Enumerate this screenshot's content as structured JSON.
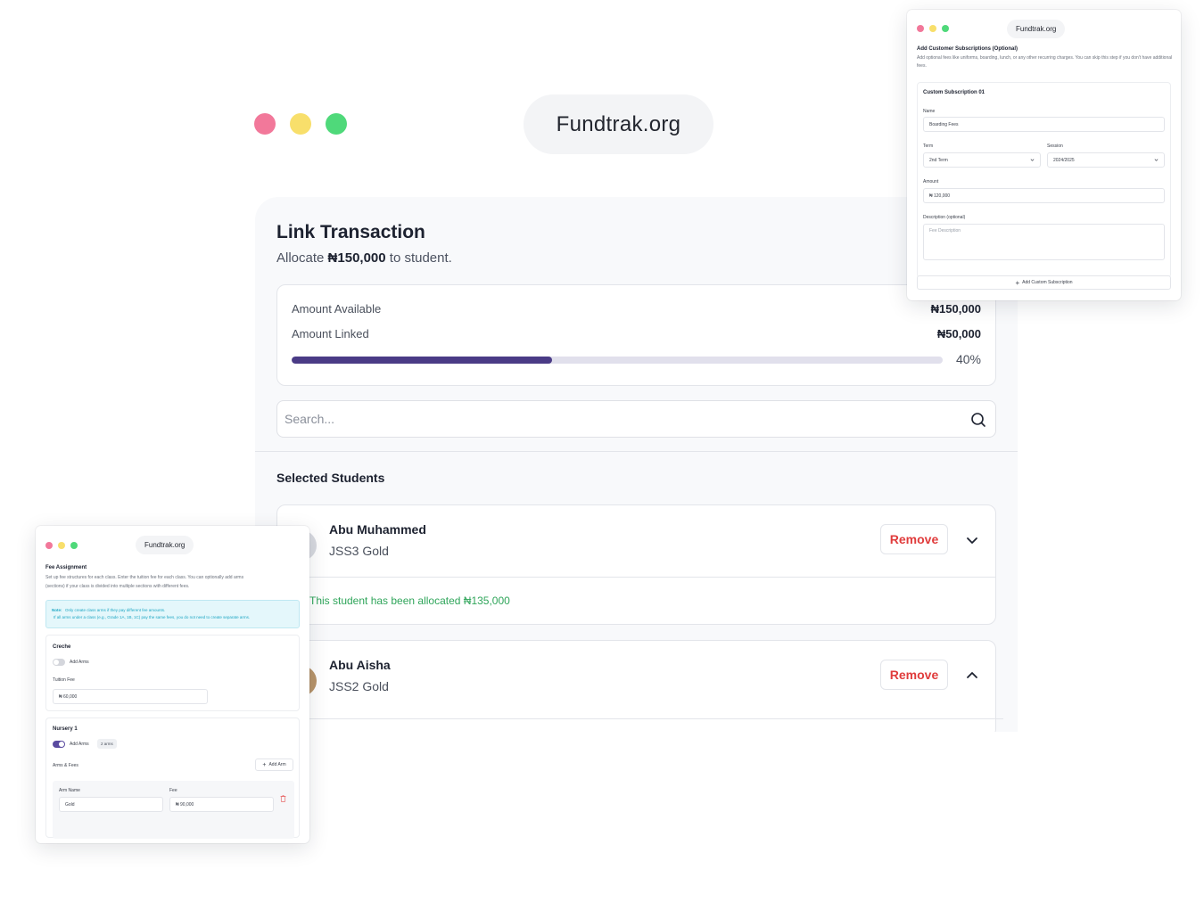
{
  "main_window": {
    "url": "Fundtrak.org",
    "title": "Link Transaction",
    "subtitle_prefix": "Allocate",
    "subtitle_amount": "₦150,000",
    "subtitle_suffix": "to student.",
    "summary": {
      "available_label": "Amount Available",
      "available_value": "₦150,000",
      "linked_label": "Amount Linked",
      "linked_value": "₦50,000",
      "progress_percent": 40,
      "progress_text": "40%"
    },
    "search": {
      "placeholder": "Search..."
    },
    "selected_title": "Selected Students",
    "students": [
      {
        "name": "Abu Muhammed",
        "class": "JSS3 Gold",
        "remove_label": "Remove",
        "expanded": true,
        "allocation_note": "This student has been allocated  ₦135,000"
      },
      {
        "name": "Abu Aisha",
        "class": "JSS2 Gold",
        "remove_label": "Remove",
        "expanded": false
      }
    ]
  },
  "subscription_window": {
    "url": "Fundtrak.org",
    "heading": "Add Customer Subscriptions (Optional)",
    "description": "Add optional fees like uniforms, boarding, lunch, or any other recurring charges. You can skip this step if you don't have additional fees.",
    "card_title": "Custom Subscription 01",
    "name_label": "Name",
    "name_value": "Boarding Fees",
    "term_label": "Term",
    "term_value": "2nd Term",
    "session_label": "Session",
    "session_value": "2024/2025",
    "amount_label": "Amount",
    "amount_value": "₦ 120,000",
    "description_label": "Description (optional)",
    "description_placeholder": "Fee Description",
    "add_button": "Add Custom Subscription"
  },
  "fee_window": {
    "url": "Fundtrak.org",
    "heading": "Fee Assignment",
    "description_line1": "Set up fee structures for each class. Enter the tuition fee for each class. You can optionally add arms",
    "description_line2": "(sections) if your class is divided into multiple sections with different fees.",
    "note_prefix": "Note:",
    "note_line1": "Only create class arms if they pay different fee amounts.",
    "note_line2": "If all arms under a class (e.g., Grade 1A, 1B, 1C) pay the same fees, you do not need to create separate arms.",
    "classes": [
      {
        "name": "Creche",
        "add_arms_label": "Add Arms",
        "tuition_label": "Tuition Fee",
        "tuition_value": "₦ 60,000"
      },
      {
        "name": "Nursery 1",
        "add_arms_label": "Add Arms",
        "arms_count": "2 arms",
        "arms_fees_label": "Arms & Fees",
        "add_arm_button": "Add Arm",
        "arm_name_label": "Arm Name",
        "arm_name_value": "Gold",
        "fee_label": "Fee",
        "fee_value": "₦ 90,000"
      }
    ]
  },
  "colors": {
    "accent": "#4a3b86",
    "danger": "#e03c3c",
    "success": "#2fa55a",
    "dot_red": "#f2789a",
    "dot_yellow": "#f8df6b",
    "dot_green": "#4fd97a"
  }
}
